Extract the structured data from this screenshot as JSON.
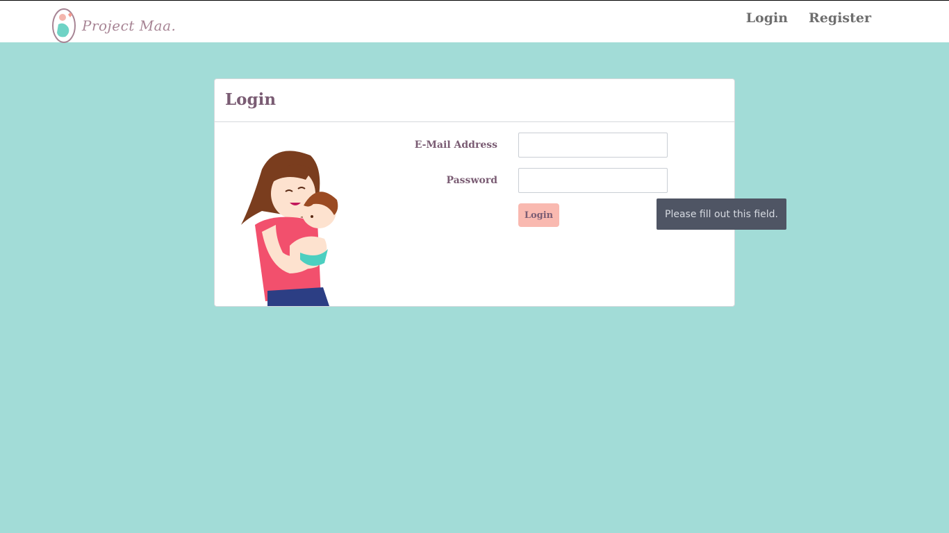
{
  "navbar": {
    "brand_name": "Project Maa.",
    "links": [
      {
        "label": "Login"
      },
      {
        "label": "Register"
      }
    ]
  },
  "card": {
    "title": "Login",
    "form": {
      "email_label": "E-Mail Address",
      "email_value": "",
      "password_label": "Password",
      "password_value": "",
      "submit_label": "Login"
    }
  },
  "tooltip": {
    "message": "Please fill out this field."
  },
  "colors": {
    "page_background": "#a2dcd7",
    "card_title": "#7a5c73",
    "button_bg": "#f9b9b0",
    "tooltip_bg": "#4f5564"
  }
}
